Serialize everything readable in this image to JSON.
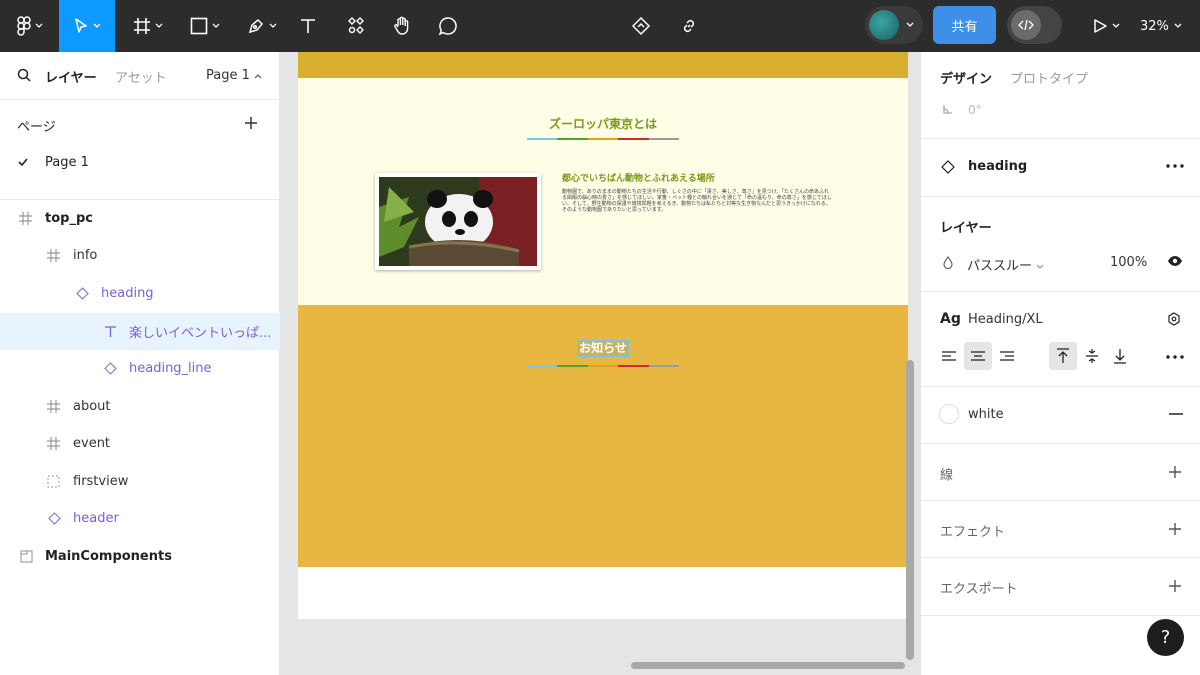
{
  "toolbar": {
    "share_label": "共有",
    "zoom": "32%"
  },
  "left_panel": {
    "tab_layers": "レイヤー",
    "tab_assets": "アセット",
    "page_selector": "Page 1",
    "pages_header": "ページ",
    "pages": [
      "Page 1"
    ],
    "layers": [
      {
        "name": "top_pc",
        "kind": "frame"
      },
      {
        "name": "info",
        "kind": "frame"
      },
      {
        "name": "heading",
        "kind": "component"
      },
      {
        "name": "楽しいイベントいっぱ...",
        "kind": "text"
      },
      {
        "name": "heading_line",
        "kind": "component"
      },
      {
        "name": "about",
        "kind": "frame"
      },
      {
        "name": "event",
        "kind": "frame"
      },
      {
        "name": "firstview",
        "kind": "section"
      },
      {
        "name": "header",
        "kind": "component"
      },
      {
        "name": "MainComponents",
        "kind": "section"
      }
    ]
  },
  "canvas": {
    "info_heading": "ズーロッパ東京とは",
    "info_subheading": "都心でいちばん動物とふれあえる場所",
    "info_body": "動物園で、ありのままの動物たちの生活や行動、しぐさの中に「凄さ、美しさ、尊さ」を見つけ、「たくさんの命あふれる閑暇の脳心時の豊さ」を感じてほしい。家畜・ペット種との触れ合いを通じて「命の温もり、命の尊さ」を感じてほしい。そして、野生動物の保護や環境問題を考えるき、動物たちは私たちと対等な生き物なんだと思うきっかけになれる。そのような動物園でありたいと思っています。",
    "news_heading": "お知らせ",
    "heading_line_colors": [
      "#7cc7e3",
      "#5aa02c",
      "#e1a21a",
      "#c9302c",
      "#9c9c9c"
    ]
  },
  "right_panel": {
    "tab_design": "デザイン",
    "tab_prototype": "プロトタイプ",
    "rotation": "0°",
    "component_name": "heading",
    "layer_header": "レイヤー",
    "blend_mode": "パススルー",
    "opacity": "100%",
    "text_style_label": "Ag",
    "text_style": "Heading/XL",
    "fill_name": "white",
    "stroke_label": "線",
    "effects_label": "エフェクト",
    "export_label": "エクスポート",
    "help": "?"
  }
}
